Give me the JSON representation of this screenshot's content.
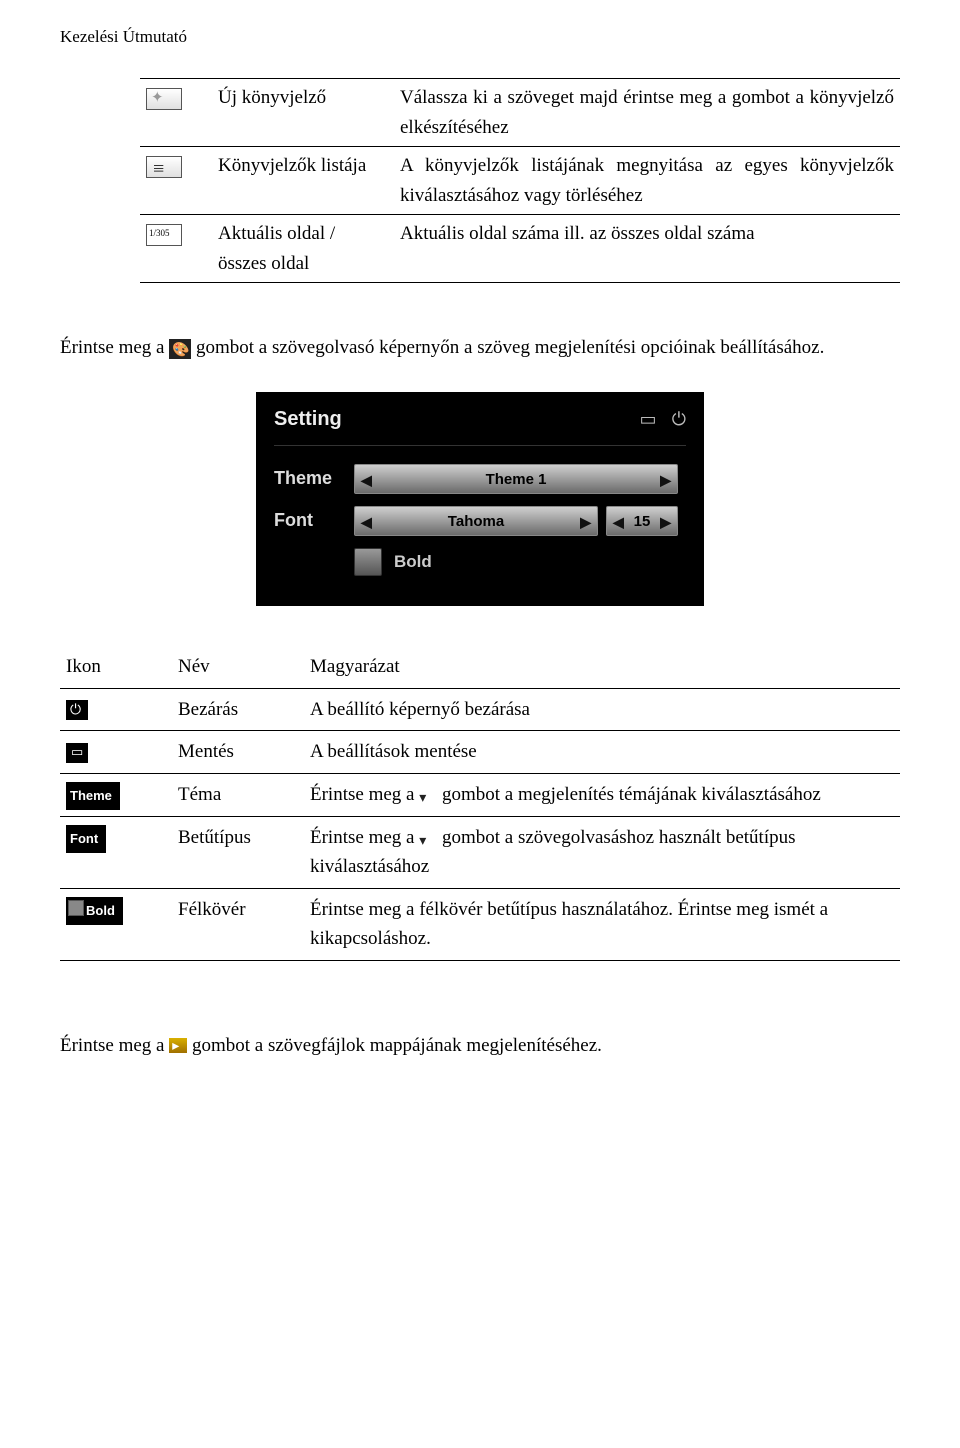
{
  "header": {
    "title": "Kezelési Útmutató"
  },
  "table1": {
    "rows": [
      {
        "icon": "star",
        "name": "Új könyvjelző",
        "desc": "Válassza ki a szöveget majd érintse meg a gombot a könyvjelző elkészítéséhez"
      },
      {
        "icon": "list",
        "name": "Könyvjelzők listája",
        "desc": "A könyvjelzők listájának megnyitása az egyes könyvjelzők kiválasztásához vagy törléséhez"
      },
      {
        "icon": "pages",
        "iconLabel": "1/305",
        "name": "Aktuális oldal / összes oldal",
        "desc": "Aktuális oldal száma ill. az összes oldal száma"
      }
    ]
  },
  "paragraph1": {
    "before": "Érintse meg a",
    "after": "gombot a szövegolvasó képernyőn a szöveg megjelenítési opcióinak beállításához."
  },
  "settings": {
    "title": "Setting",
    "themeLabel": "Theme",
    "themeValue": "Theme 1",
    "fontLabel": "Font",
    "fontValue": "Tahoma",
    "fontSize": "15",
    "boldLabel": "Bold"
  },
  "table2": {
    "headers": {
      "icon": "Ikon",
      "name": "Név",
      "desc": "Magyarázat"
    },
    "rows": [
      {
        "iconClass": "icon-power",
        "name": "Bezárás",
        "desc": "A beállító képernyő bezárása"
      },
      {
        "iconClass": "icon-save",
        "name": "Mentés",
        "desc": "A beállítások mentése"
      },
      {
        "iconClass": "theme-label",
        "iconText": "Theme",
        "name": "Téma",
        "descBefore": "Érintse meg a",
        "descAfter": "gombot a megjelenítés témájának kiválasztásához",
        "inlineArrow": true
      },
      {
        "iconClass": "font-label",
        "iconText": "Font",
        "name": "Betűtípus",
        "descBefore": "Érintse meg a",
        "descAfter": "gombot a szövegolvasáshoz használt betűtípus kiválasztásához",
        "inlineArrow": true
      },
      {
        "iconClass": "bold-label",
        "iconText": "Bold",
        "name": "Félkövér",
        "desc": "Érintse meg a félkövér betűtípus használatához. Érintse meg ismét a kikapcsoláshoz."
      }
    ]
  },
  "paragraph2": {
    "before": "Érintse meg a",
    "after": "gombot a szövegfájlok mappájának megjelenítéséhez."
  }
}
